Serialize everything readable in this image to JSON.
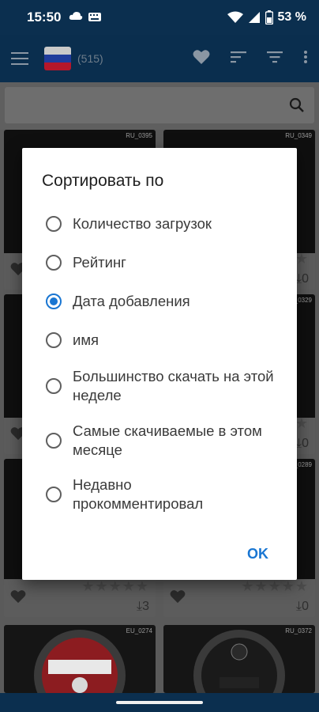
{
  "status_bar": {
    "time": "15:50",
    "battery": "53 %",
    "icons": [
      "cloud-icon",
      "keyboard-icon",
      "wifi-icon",
      "signal-icon",
      "battery-icon"
    ]
  },
  "app_bar": {
    "count": "(515)",
    "icons": [
      "menu-icon",
      "flag-russia",
      "favorite-icon",
      "sort-icon",
      "filter-icon",
      "more-icon"
    ]
  },
  "search": {
    "placeholder": ""
  },
  "cards": [
    {
      "code": "RU_0395",
      "downloads": ""
    },
    {
      "code": "RU_0349",
      "downloads": "0"
    },
    {
      "code": "",
      "downloads": ""
    },
    {
      "code": "RU_0329",
      "downloads": "0"
    },
    {
      "code": "",
      "downloads": "3"
    },
    {
      "code": "RU_0289",
      "downloads": "0"
    },
    {
      "code": "EU_0274",
      "downloads": ""
    },
    {
      "code": "RU_0372",
      "downloads": ""
    }
  ],
  "dialog": {
    "title": "Сортировать по",
    "options": [
      {
        "label": "Количество загрузок",
        "checked": false
      },
      {
        "label": "Рейтинг",
        "checked": false
      },
      {
        "label": "Дата добавления",
        "checked": true
      },
      {
        "label": "имя",
        "checked": false
      },
      {
        "label": "Большинство скачать на этой неделе",
        "checked": false
      },
      {
        "label": "Самые скачиваемые в этом месяце",
        "checked": false
      },
      {
        "label": "Недавно прокомментировал",
        "checked": false
      }
    ],
    "ok_label": "OK"
  },
  "colors": {
    "accent": "#1976d2",
    "app_bar": "#0a2e4e"
  }
}
